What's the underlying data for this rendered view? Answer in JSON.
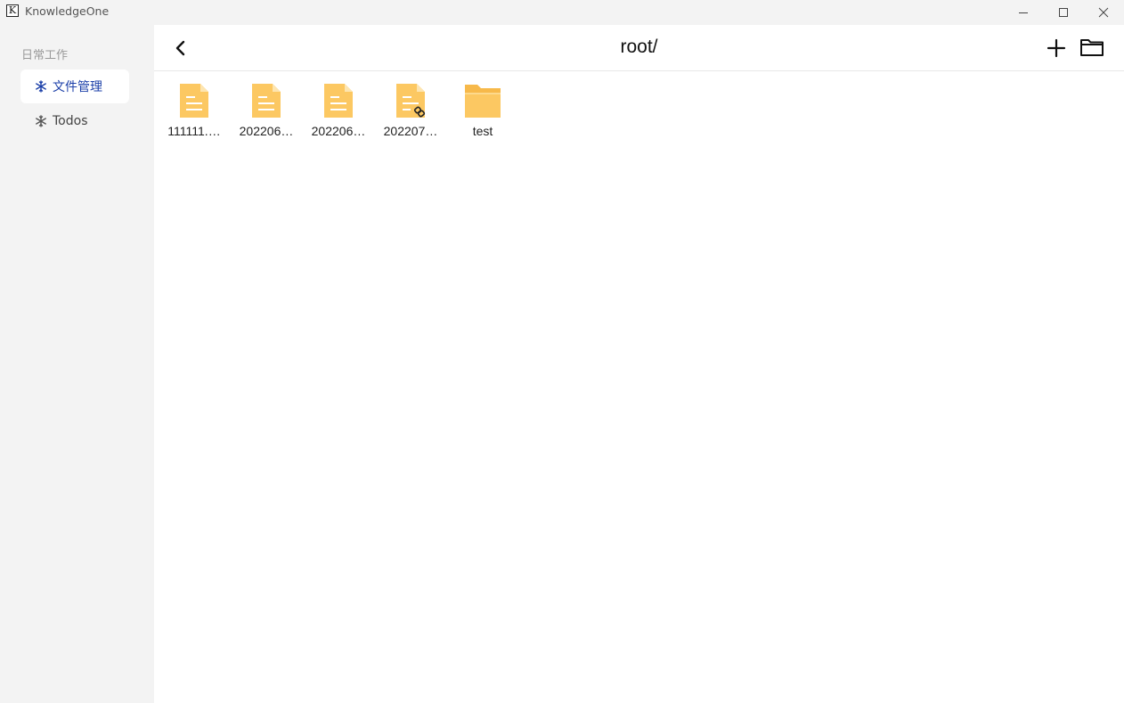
{
  "window": {
    "title": "KnowledgeOne",
    "logo_letter": "K"
  },
  "sidebar": {
    "group_title": "日常工作",
    "items": [
      {
        "label": "文件管理",
        "icon": "snowflake-icon",
        "active": true
      },
      {
        "label": "Todos",
        "icon": "snowflake-icon",
        "active": false
      }
    ]
  },
  "header": {
    "path": "root/"
  },
  "files": [
    {
      "name": "111111.…",
      "type": "document"
    },
    {
      "name": "202206…",
      "type": "document"
    },
    {
      "name": "202206…",
      "type": "document"
    },
    {
      "name": "202207…",
      "type": "document-linked"
    },
    {
      "name": "test",
      "type": "folder"
    }
  ],
  "colors": {
    "accent": "#1b3fa8",
    "file_icon": "#fcc862",
    "folder_icon": "#fcc862"
  }
}
